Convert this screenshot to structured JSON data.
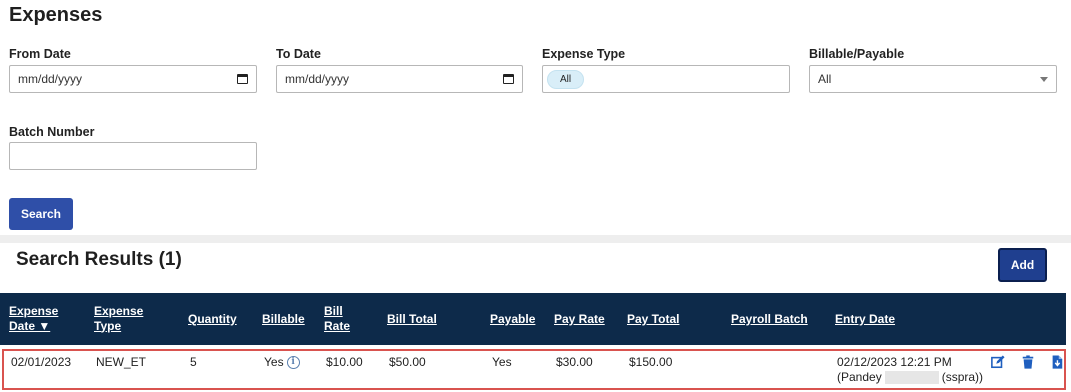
{
  "page": {
    "title": "Expenses"
  },
  "filters": {
    "from_date": {
      "label": "From Date",
      "placeholder": "mm/dd/yyyy"
    },
    "to_date": {
      "label": "To Date",
      "placeholder": "mm/dd/yyyy"
    },
    "expense_type": {
      "label": "Expense Type",
      "value": "All"
    },
    "billable_payable": {
      "label": "Billable/Payable",
      "value": "All"
    },
    "batch_number": {
      "label": "Batch Number",
      "value": ""
    },
    "search_button": "Search"
  },
  "results": {
    "title": "Search Results (1)",
    "add_button": "Add",
    "columns": {
      "expense_date_line1": "Expense",
      "expense_date_line2": "Date ▼",
      "expense_type_line1": "Expense",
      "expense_type_line2": "Type",
      "quantity": "Quantity",
      "billable": "Billable",
      "bill_rate_line1": "Bill",
      "bill_rate_line2": "Rate",
      "bill_total": "Bill Total",
      "payable": "Payable",
      "pay_rate": "Pay Rate",
      "pay_total": "Pay Total",
      "payroll_batch": "Payroll Batch",
      "entry_date": "Entry Date"
    },
    "rows": [
      {
        "expense_date": "02/01/2023",
        "expense_type": "NEW_ET",
        "quantity": "5",
        "billable": "Yes",
        "bill_rate": "$10.00",
        "bill_total": "$50.00",
        "payable": "Yes",
        "pay_rate": "$30.00",
        "pay_total": "$150.00",
        "payroll_batch": "",
        "entry_date_line1": "02/12/2023 12:21 PM",
        "entry_user_first": "(Pandey",
        "entry_user_id": "(sspra))",
        "row_actions": [
          "edit-icon",
          "trash-icon",
          "file-download-icon"
        ]
      }
    ]
  },
  "colors": {
    "header_bg": "#0d2a4a",
    "primary_button": "#2f4fa8",
    "highlight_border": "#d9534f",
    "action_icon": "#1f5fbf"
  }
}
